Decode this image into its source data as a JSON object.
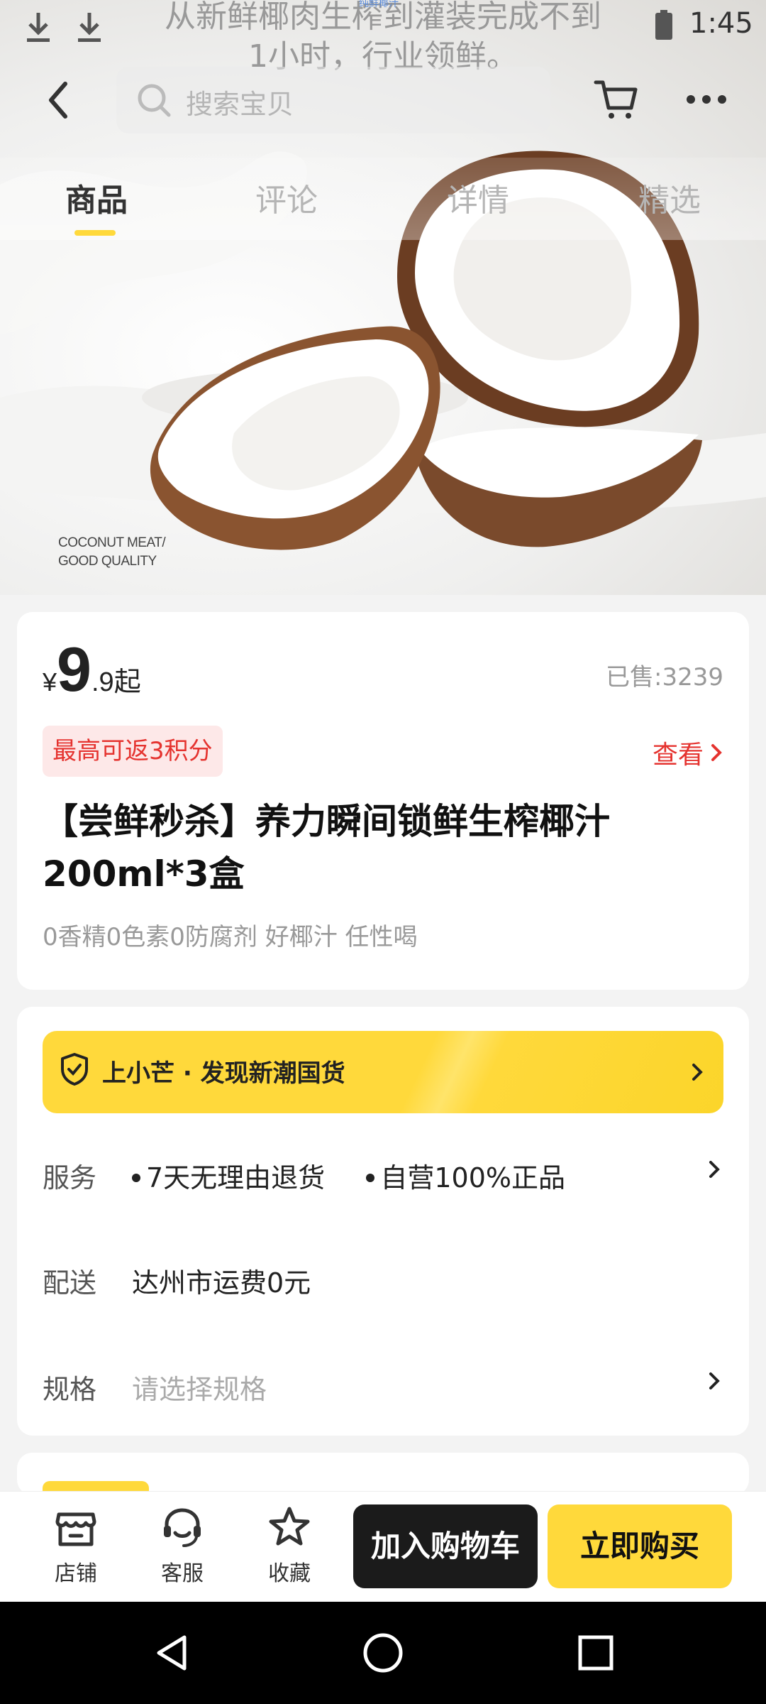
{
  "status_bar": {
    "time": "1:45"
  },
  "overlay": {
    "text_line1": "从新鲜椰肉生榨到灌装完成不到",
    "text_line2": "1小时，行业领鲜。",
    "small": "纯鲜椰汁"
  },
  "nav": {
    "search_placeholder": "搜索宝贝"
  },
  "tabs": [
    {
      "label": "商品",
      "active": true
    },
    {
      "label": "评论",
      "active": false
    },
    {
      "label": "详情",
      "active": false
    },
    {
      "label": "精选",
      "active": false
    }
  ],
  "hero": {
    "caption_line1": "COCONUT MEAT/",
    "caption_line2": "GOOD QUALITY"
  },
  "product": {
    "price_currency": "¥",
    "price_int": "9",
    "price_dec": ".9",
    "price_suffix": "起",
    "sold": "已售:3239",
    "points_badge": "最高可返3积分",
    "view_link": "查看",
    "title": "【尝鲜秒杀】养力瞬间锁鲜生榨椰汁200ml*3盒",
    "subtitle": "0香精0色素0防腐剂 好椰汁 任性喝"
  },
  "promo": {
    "text": "上小芒 · 发现新潮国货"
  },
  "rows": {
    "service_label": "服务",
    "service_item1": "7天无理由退货",
    "service_item2": "自营100%正品",
    "delivery_label": "配送",
    "delivery_value": "达州市运费0元",
    "spec_label": "规格",
    "spec_placeholder": "请选择规格"
  },
  "bottom_bar": {
    "store": "店铺",
    "service": "客服",
    "favorite": "收藏",
    "add_to_cart": "加入购物车",
    "buy_now": "立即购买"
  },
  "colors": {
    "accent_yellow": "#ffd93b",
    "price_red": "#e5332f",
    "dark_button": "#1b1b1b"
  }
}
